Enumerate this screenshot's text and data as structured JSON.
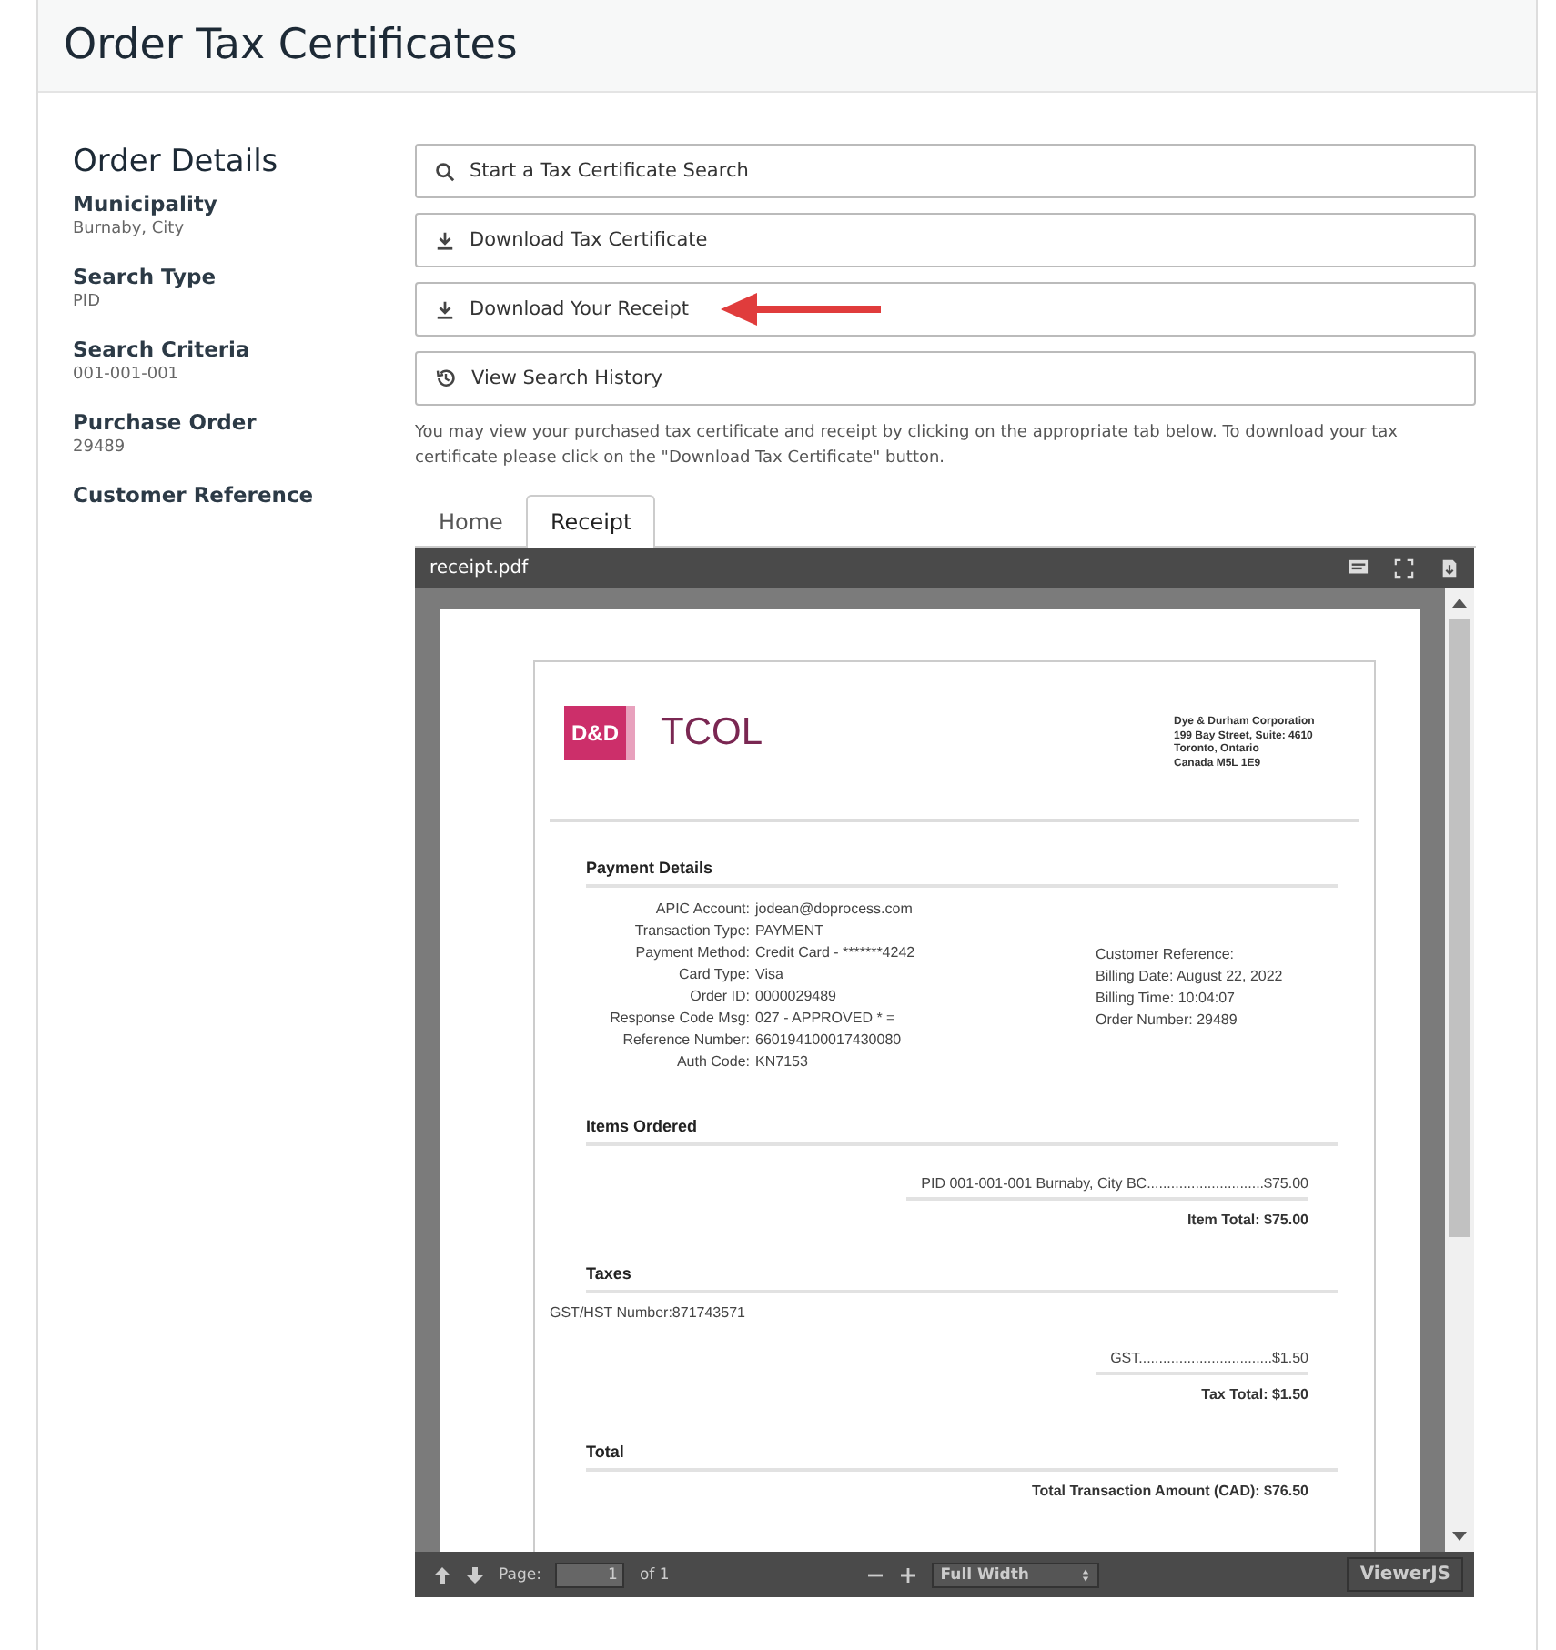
{
  "header": {
    "title": "Order Tax Certificates"
  },
  "details": {
    "title": "Order Details",
    "fields": [
      {
        "label": "Municipality",
        "value": "Burnaby, City"
      },
      {
        "label": "Search Type",
        "value": "PID"
      },
      {
        "label": "Search Criteria",
        "value": "001-001-001"
      },
      {
        "label": "Purchase Order",
        "value": "29489"
      },
      {
        "label": "Customer Reference"
      }
    ]
  },
  "actions": [
    {
      "kind": "search",
      "label": "Start a Tax Certificate Search",
      "annotated": false
    },
    {
      "kind": "download",
      "label": "Download Tax Certificate",
      "annotated": false
    },
    {
      "kind": "download",
      "label": "Download Your Receipt",
      "annotated": true
    },
    {
      "kind": "history",
      "label": "View Search History",
      "annotated": false
    }
  ],
  "note": "You may view your purchased tax certificate and receipt by clicking on the appropriate tab below. To download your tax certificate please click on the \"Download Tax Certificate\" button.",
  "tabs": [
    {
      "label": "Home",
      "selected": false
    },
    {
      "label": "Receipt",
      "selected": true
    }
  ],
  "viewer": {
    "filename": "receipt.pdf",
    "doc": {
      "logo_mark": "D&D",
      "brand": "TCOL",
      "address": [
        "Dye & Durham Corporation",
        "199 Bay Street, Suite: 4610",
        "Toronto, Ontario",
        "Canada M5L 1E9"
      ],
      "payment_title": "Payment Details",
      "payment_rows": [
        {
          "label": "APIC Account:",
          "value": "jodean@doprocess.com"
        },
        {
          "label": "Transaction Type:",
          "value": "PAYMENT"
        },
        {
          "label": "Payment Method:",
          "value": "Credit Card - *******4242"
        },
        {
          "label": "Card Type:",
          "value": "Visa"
        },
        {
          "label": "Order ID:",
          "value": "0000029489"
        },
        {
          "label": "Response Code Msg:",
          "value": "027 - APPROVED * ="
        },
        {
          "label": "Reference Number:",
          "value": "660194100017430080"
        },
        {
          "label": "Auth Code:",
          "value": "KN7153"
        }
      ],
      "payment_side": [
        "Customer Reference:",
        "Billing Date: August 22, 2022",
        "Billing Time: 10:04:07",
        "Order Number: 29489"
      ],
      "items_title": "Items Ordered",
      "item_line": "PID 001-001-001 Burnaby, City BC.............................$75.00",
      "item_total": "Item Total: $75.00",
      "taxes_title": "Taxes",
      "gst_number": "GST/HST Number:871743571",
      "tax_line": "GST.................................$1.50",
      "tax_total": "Tax Total: $1.50",
      "total_title": "Total",
      "total_line": "Total Transaction Amount (CAD): $76.50"
    },
    "toolbar": {
      "page_label": "Page:",
      "page_value": "1",
      "page_count": "of 1",
      "zoom": "Full Width",
      "brand": "ViewerJS"
    }
  }
}
